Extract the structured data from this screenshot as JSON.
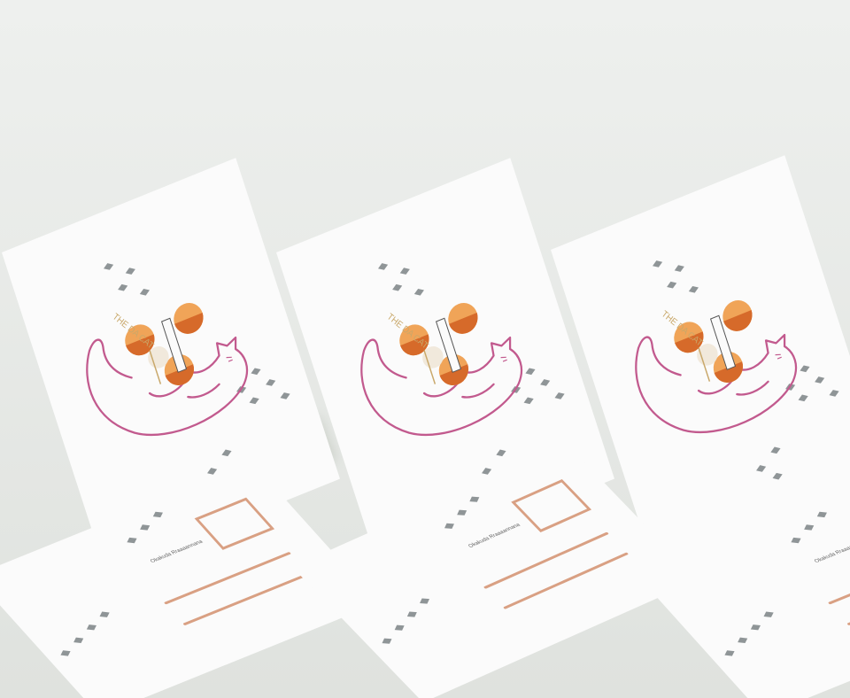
{
  "scene": {
    "description_free": true,
    "colors": {
      "background": "#e9ece9",
      "card": "#fbfbfb",
      "cat_line": "#c25a8e",
      "fruit_orange": "#e8893a",
      "fruit_dark": "#d4652a",
      "stamp_outline": "#d9a083",
      "diamond": "#8f9597",
      "label_gold": "#c9a86a"
    }
  },
  "front_card": {
    "title": "THE DA CAT",
    "stamp_text": "OKAKUDA RRAAAAANNANA"
  },
  "postcard_back": {
    "address_label": "Okakuda Rraaaannana"
  },
  "icons": {
    "cat": "cat-line-drawing",
    "fruit": "orange-fruit",
    "diamond": "diamond-pattern",
    "stamp": "stamp-box"
  }
}
